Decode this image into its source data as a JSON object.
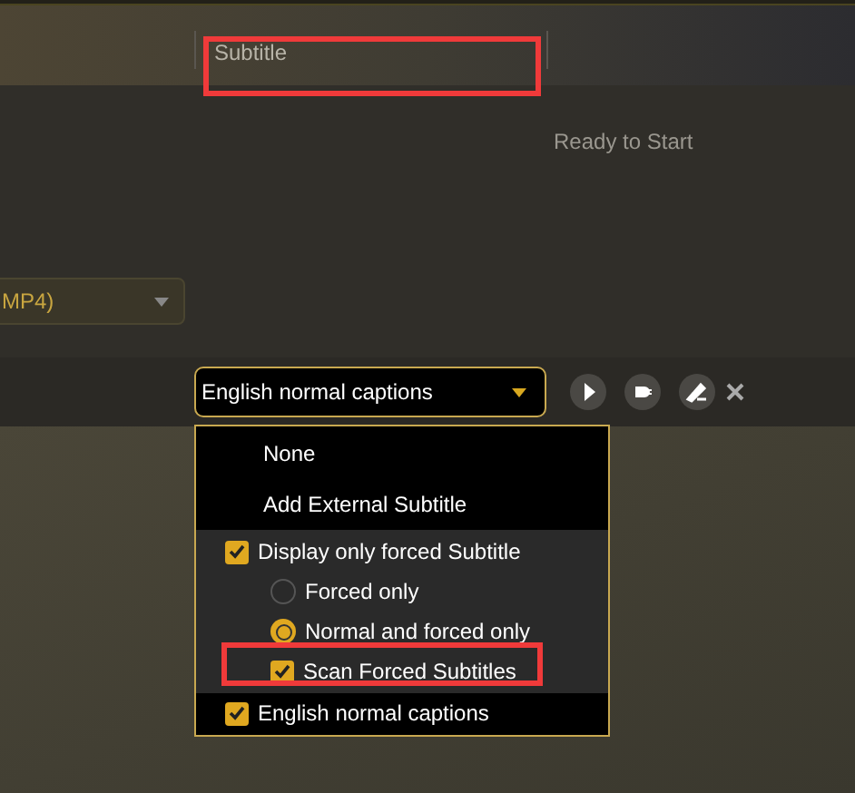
{
  "header": {
    "title": "Subtitle"
  },
  "status": "Ready to Start",
  "format_dropdown": {
    "value": "MP4)"
  },
  "subtitle_dropdown": {
    "value": "English normal captions"
  },
  "menu": [
    {
      "kind": "plain",
      "label": "None"
    },
    {
      "kind": "plain",
      "label": "Add External Subtitle"
    },
    {
      "kind": "checkbox",
      "label": "Display only forced Subtitle",
      "checked": true,
      "children": [
        {
          "kind": "radio",
          "label": "Forced only",
          "selected": false
        },
        {
          "kind": "radio",
          "label": "Normal and forced only",
          "selected": true
        },
        {
          "kind": "checkbox",
          "label": "Scan Forced Subtitles",
          "checked": true
        }
      ]
    },
    {
      "kind": "track",
      "label": "English normal captions",
      "checked": true
    }
  ]
}
